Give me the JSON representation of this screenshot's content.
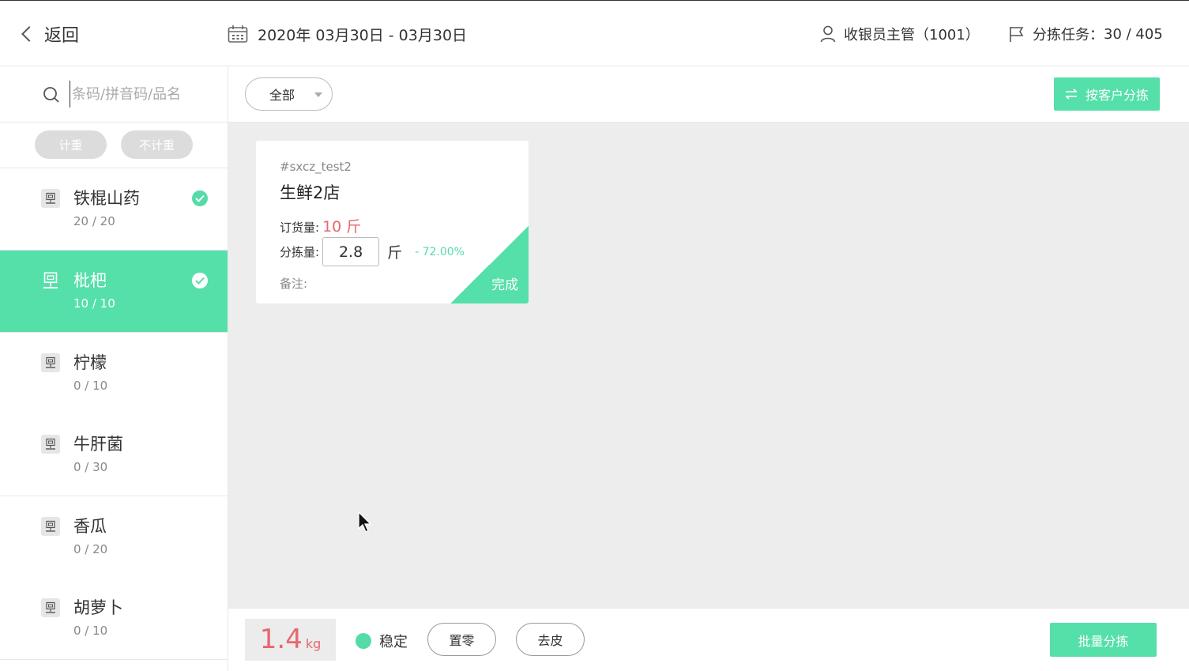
{
  "header": {
    "back_label": "返回",
    "date_range": "2020年 03月30日 - 03月30日",
    "user": "收银员主管（1001）",
    "task_label": "分拣任务：",
    "task_value": "30 / 405"
  },
  "sidebar": {
    "search_placeholder": "条码/拼音码/品名",
    "filters": [
      "计重",
      "不计重"
    ],
    "items": [
      {
        "name": "铁棍山药",
        "count": "20 / 20",
        "done": true,
        "active": false
      },
      {
        "name": "枇杷",
        "count": "10 / 10",
        "done": true,
        "active": true
      },
      {
        "name": "柠檬",
        "count": "0 / 10",
        "done": false,
        "active": false
      },
      {
        "name": "牛肝菌",
        "count": "0 / 30",
        "done": false,
        "active": false
      },
      {
        "name": "香瓜",
        "count": "0 / 20",
        "done": false,
        "active": false
      },
      {
        "name": "胡萝卜",
        "count": "0 / 10",
        "done": false,
        "active": false
      }
    ]
  },
  "toolbar": {
    "select_value": "全部",
    "by_customer_label": "按客户分拣"
  },
  "card": {
    "code": "#sxcz_test2",
    "store": "生鲜2店",
    "ordered_label": "订货量:",
    "ordered_value": "10 斤",
    "sorted_label": "分拣量:",
    "sorted_value": "2.8",
    "sorted_unit": "斤",
    "diff": "- 72.00%",
    "note_label": "备注:",
    "status": "完成"
  },
  "bottom": {
    "weight": "1.4",
    "weight_unit": "kg",
    "stable_label": "稳定",
    "zero_label": "置零",
    "tare_label": "去皮",
    "batch_label": "批量分拣"
  },
  "colors": {
    "accent": "#55dfa9",
    "warn": "#e8666e"
  }
}
